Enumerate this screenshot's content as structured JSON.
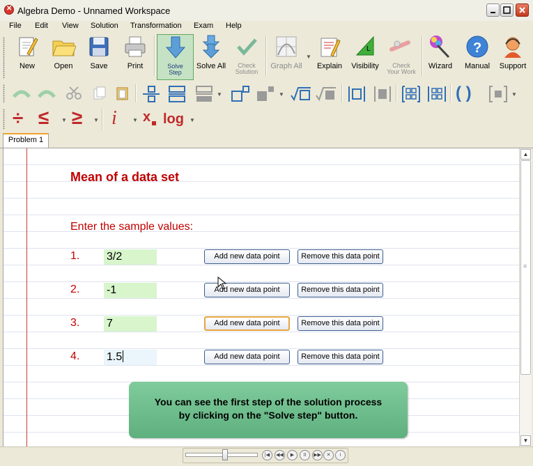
{
  "window": {
    "title": "Algebra Demo - Unnamed Workspace"
  },
  "menu": [
    "File",
    "Edit",
    "View",
    "Solution",
    "Transformation",
    "Exam",
    "Help"
  ],
  "toolbar": {
    "new": "New",
    "open": "Open",
    "save": "Save",
    "print": "Print",
    "solve_step_1": "Solve",
    "solve_step_2": "Step",
    "solve_all": "Solve All",
    "check_solution_1": "Check",
    "check_solution_2": "Solution",
    "graph_all": "Graph All",
    "explain": "Explain",
    "visibility": "Visibility",
    "check_work_1": "Check",
    "check_work_2": "Your Work",
    "wizard": "Wizard",
    "manual": "Manual",
    "support": "Support"
  },
  "format_bar": {
    "divide": "÷",
    "leq": "≤",
    "geq": "≥",
    "imag": "i",
    "subscript": "x",
    "log": "log",
    "parens": "( )"
  },
  "tabs": [
    "Problem 1"
  ],
  "worksheet": {
    "heading": "Mean of a data set",
    "prompt": "Enter the sample values:",
    "rows": [
      {
        "num": "1.",
        "value": "3/2"
      },
      {
        "num": "2.",
        "value": "-1"
      },
      {
        "num": "3.",
        "value": "7"
      },
      {
        "num": "4.",
        "value": "1.5"
      }
    ],
    "add_label": "Add new data point",
    "remove_label": "Remove this data point",
    "hint_line1": "You can see the first step of the solution process",
    "hint_line2": "by clicking on the \"Solve step\" button."
  },
  "colors": {
    "heading": "#c00000",
    "field": "#d8f5cc",
    "hint": "#6fbe8e",
    "accent": "#f0a030"
  }
}
